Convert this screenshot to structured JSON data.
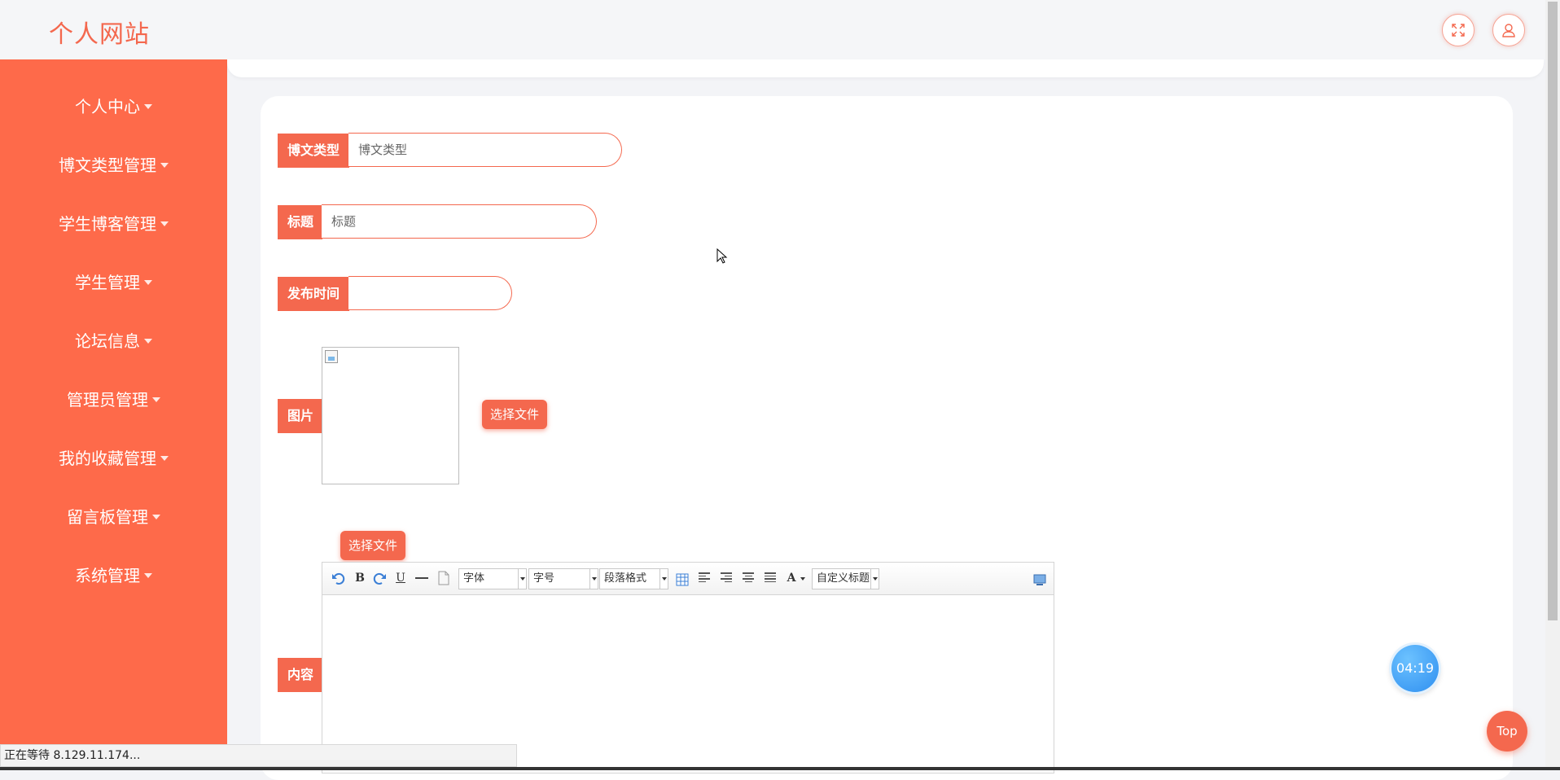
{
  "app": {
    "title": "个人网站"
  },
  "header": {
    "fullscreen_icon": "expand-arrows-icon",
    "user_icon": "user-icon"
  },
  "sidebar": {
    "items": [
      {
        "label": "个人中心"
      },
      {
        "label": "博文类型管理"
      },
      {
        "label": "学生博客管理"
      },
      {
        "label": "学生管理"
      },
      {
        "label": "论坛信息"
      },
      {
        "label": "管理员管理"
      },
      {
        "label": "我的收藏管理"
      },
      {
        "label": "留言板管理"
      },
      {
        "label": "系统管理"
      }
    ]
  },
  "form": {
    "type": {
      "label": "博文类型",
      "placeholder": "博文类型",
      "value": ""
    },
    "title": {
      "label": "标题",
      "placeholder": "标题",
      "value": ""
    },
    "publish_time": {
      "label": "发布时间",
      "value": ""
    },
    "image": {
      "label": "图片",
      "choose_button": "选择文件"
    },
    "content": {
      "label": "内容",
      "choose_button": "选择文件",
      "toolbar": {
        "font_family": "字体",
        "font_size": "字号",
        "paragraph": "段落格式",
        "custom_title": "自定义标题",
        "bold": "B",
        "underline": "U",
        "font_color": "A"
      }
    }
  },
  "floating": {
    "timer": "04:19",
    "top_button": "Top"
  },
  "browser": {
    "status_text": "正在等待 8.129.11.174..."
  },
  "colors": {
    "accent": "#f4684e",
    "sidebar": "#fe6a4a",
    "timer": "#2f8ff0"
  }
}
